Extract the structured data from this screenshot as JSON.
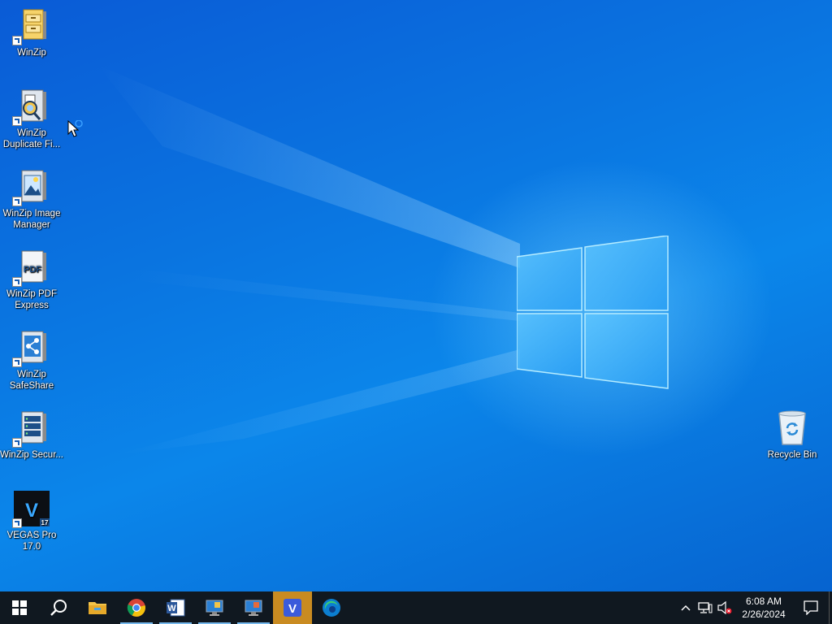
{
  "desktop": {
    "icons": [
      {
        "label": "WinZip",
        "icon": "winzip-cabinet-icon"
      },
      {
        "label": "WinZip Duplicate Fi...",
        "icon": "winzip-duplicate-finder-icon"
      },
      {
        "label": "WinZip Image Manager",
        "icon": "winzip-image-manager-icon"
      },
      {
        "label": "WinZip PDF Express",
        "icon": "winzip-pdf-express-icon",
        "badge": "PDF"
      },
      {
        "label": "WinZip SafeShare",
        "icon": "winzip-safeshare-icon"
      },
      {
        "label": "WinZip Secur...",
        "icon": "winzip-secure-backup-icon"
      },
      {
        "label": "VEGAS Pro 17.0",
        "icon": "vegas-pro-icon",
        "badge": "V",
        "version_badge": "17"
      },
      {
        "label": "Recycle Bin",
        "icon": "recycle-bin-icon"
      }
    ]
  },
  "taskbar": {
    "apps": [
      {
        "name": "start",
        "icon": "windows-start-icon"
      },
      {
        "name": "search",
        "icon": "search-icon"
      },
      {
        "name": "file-explorer",
        "icon": "folder-icon"
      },
      {
        "name": "chrome",
        "icon": "chrome-icon"
      },
      {
        "name": "word",
        "icon": "word-icon",
        "badge": "W"
      },
      {
        "name": "app-monitor-1",
        "icon": "monitor-app-icon"
      },
      {
        "name": "app-monitor-2",
        "icon": "monitor-app-icon"
      },
      {
        "name": "vegas",
        "icon": "vegas-icon",
        "badge": "V"
      },
      {
        "name": "edge",
        "icon": "edge-icon"
      }
    ],
    "clock": {
      "time": "6:08 AM",
      "date": "2/26/2024"
    }
  },
  "colors": {
    "taskbar": "#101820",
    "active_app": "#c98b21",
    "desktop_blue": "#0a74e0"
  }
}
